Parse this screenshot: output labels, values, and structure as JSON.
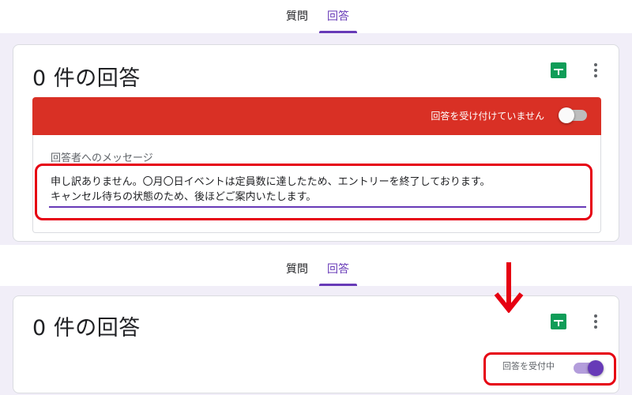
{
  "top_panel": {
    "tabs": [
      {
        "label": "質問",
        "active": false
      },
      {
        "label": "回答",
        "active": true
      }
    ],
    "title": "0 件の回答",
    "banner_label": "回答を受け付けていません",
    "accepting_responses": false,
    "message_label": "回答者へのメッセージ",
    "message_line1": "申し訳ありません。〇月〇日イベントは定員数に達したため、エントリーを終了しております。",
    "message_line2": "キャンセル待ちの状態のため、後ほどご案内いたします。"
  },
  "bottom_panel": {
    "tabs": [
      {
        "label": "質問",
        "active": false
      },
      {
        "label": "回答",
        "active": true
      }
    ],
    "title": "0 件の回答",
    "accepting_label": "回答を受付中",
    "accepting_responses": true
  },
  "icons": {
    "sheets": "google-sheets-icon",
    "more": "more-vert-icon",
    "arrow": "down-arrow-icon"
  },
  "colors": {
    "accent_purple": "#673ab7",
    "banner_red": "#d93025",
    "highlight_red": "#e60012",
    "sheets_green": "#0f9d58",
    "page_bg": "#f1eef8"
  }
}
